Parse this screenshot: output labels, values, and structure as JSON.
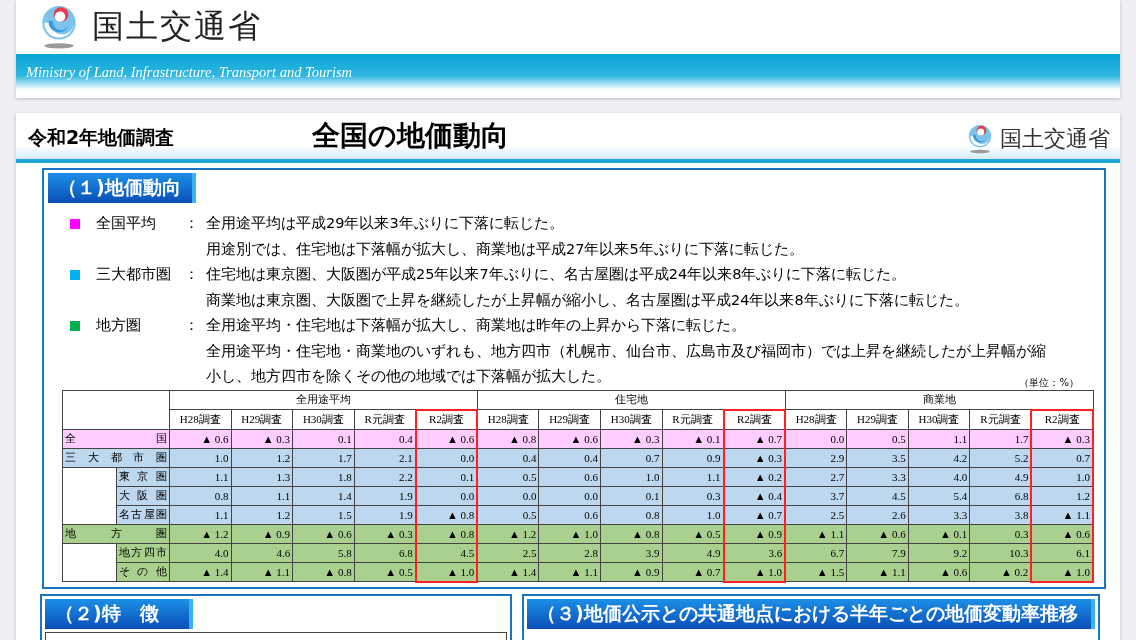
{
  "site_header": {
    "logo_text": "国土交通省",
    "tagline": "Ministry of Land, Infrastructure, Transport and Tourism"
  },
  "slide": {
    "survey_label": "令和2年地価調査",
    "title": "全国の地価動向",
    "logo_text": "国土交通省",
    "section_1": {
      "heading": "（１)地価動向",
      "summary": [
        {
          "label": "全国平均",
          "color": "#ff00ff",
          "separator": "：",
          "lines": [
            "全用途平均は平成29年以来3年ぶりに下落に転じた。",
            "用途別では、住宅地は下落幅が拡大し、商業地は平成27年以来5年ぶりに下落に転じた。"
          ]
        },
        {
          "label": "三大都市圏",
          "color": "#00b0f0",
          "separator": "：",
          "lines": [
            "住宅地は東京圏、大阪圏が平成25年以来7年ぶりに、名古屋圏は平成24年以来8年ぶりに下落に転じた。",
            "商業地は東京圏、大阪圏で上昇を継続したが上昇幅が縮小し、名古屋圏は平成24年以来8年ぶりに下落に転じた。"
          ]
        },
        {
          "label": "地方圏",
          "color": "#00b050",
          "separator": "：",
          "lines": [
            "全用途平均・住宅地は下落幅が拡大し、商業地は昨年の上昇から下落に転じた。",
            "全用途平均・住宅地・商業地のいずれも、地方四市（札幌市、仙台市、広島市及び福岡市）では上昇を継続したが上昇幅が縮",
            "小し、地方四市を除くその他の地域では下落幅が拡大した。"
          ]
        }
      ],
      "unit": "（単位：%）",
      "table": {
        "groups": [
          {
            "label": "全用途平均",
            "columns": [
              {
                "label": "H28調査",
                "highlighted": false
              },
              {
                "label": "H29調査",
                "highlighted": false
              },
              {
                "label": "H30調査",
                "highlighted": false
              },
              {
                "label": "R元調査",
                "highlighted": false
              },
              {
                "label": "R2調査",
                "highlighted": true
              }
            ]
          },
          {
            "label": "住宅地",
            "columns": [
              {
                "label": "H28調査",
                "highlighted": false
              },
              {
                "label": "H29調査",
                "highlighted": false
              },
              {
                "label": "H30調査",
                "highlighted": false
              },
              {
                "label": "R元調査",
                "highlighted": false
              },
              {
                "label": "R2調査",
                "highlighted": true
              }
            ]
          },
          {
            "label": "商業地",
            "columns": [
              {
                "label": "H28調査",
                "highlighted": false
              },
              {
                "label": "H29調査",
                "highlighted": false
              },
              {
                "label": "H30調査",
                "highlighted": false
              },
              {
                "label": "R元調査",
                "highlighted": false
              },
              {
                "label": "R2調査",
                "highlighted": true
              }
            ]
          }
        ],
        "rows": [
          {
            "label": "全国",
            "color": "#ffccff",
            "values": [
              "▲ 0.6",
              "▲ 0.3",
              "0.1",
              "0.4",
              "▲ 0.6",
              "▲ 0.8",
              "▲ 0.6",
              "▲ 0.3",
              "▲ 0.1",
              "▲ 0.7",
              "0.0",
              "0.5",
              "1.1",
              "1.7",
              "▲ 0.3"
            ]
          },
          {
            "label": "三大都市圏",
            "color": "#bdd7ee",
            "values": [
              "1.0",
              "1.2",
              "1.7",
              "2.1",
              "0.0",
              "0.4",
              "0.4",
              "0.7",
              "0.9",
              "▲ 0.3",
              "2.9",
              "3.5",
              "4.2",
              "5.2",
              "0.7"
            ],
            "children": [
              {
                "label": "東京圏",
                "values": [
                  "1.1",
                  "1.3",
                  "1.8",
                  "2.2",
                  "0.1",
                  "0.5",
                  "0.6",
                  "1.0",
                  "1.1",
                  "▲ 0.2",
                  "2.7",
                  "3.3",
                  "4.0",
                  "4.9",
                  "1.0"
                ]
              },
              {
                "label": "大阪圏",
                "values": [
                  "0.8",
                  "1.1",
                  "1.4",
                  "1.9",
                  "0.0",
                  "0.0",
                  "0.0",
                  "0.1",
                  "0.3",
                  "▲ 0.4",
                  "3.7",
                  "4.5",
                  "5.4",
                  "6.8",
                  "1.2"
                ]
              },
              {
                "label": "名古屋圏",
                "values": [
                  "1.1",
                  "1.2",
                  "1.5",
                  "1.9",
                  "▲ 0.8",
                  "0.5",
                  "0.6",
                  "0.8",
                  "1.0",
                  "▲ 0.7",
                  "2.5",
                  "2.6",
                  "3.3",
                  "3.8",
                  "▲ 1.1"
                ]
              }
            ]
          },
          {
            "label": "地方圏",
            "color": "#a9d08e",
            "values": [
              "▲ 1.2",
              "▲ 0.9",
              "▲ 0.6",
              "▲ 0.3",
              "▲ 0.8",
              "▲ 1.2",
              "▲ 1.0",
              "▲ 0.8",
              "▲ 0.5",
              "▲ 0.9",
              "▲ 1.1",
              "▲ 0.6",
              "▲ 0.1",
              "0.3",
              "▲ 0.6"
            ],
            "children": [
              {
                "label": "地方四市",
                "values": [
                  "4.0",
                  "4.6",
                  "5.8",
                  "6.8",
                  "4.5",
                  "2.5",
                  "2.8",
                  "3.9",
                  "4.9",
                  "3.6",
                  "6.7",
                  "7.9",
                  "9.2",
                  "10.3",
                  "6.1"
                ]
              },
              {
                "label": "その他",
                "values": [
                  "▲ 1.4",
                  "▲ 1.1",
                  "▲ 0.8",
                  "▲ 0.5",
                  "▲ 1.0",
                  "▲ 1.4",
                  "▲ 1.1",
                  "▲ 0.9",
                  "▲ 0.7",
                  "▲ 1.0",
                  "▲ 1.5",
                  "▲ 1.1",
                  "▲ 0.6",
                  "▲ 0.2",
                  "▲ 1.0"
                ]
              }
            ]
          }
        ]
      }
    },
    "section_2": {
      "heading": "（２)特　徴"
    },
    "section_3": {
      "heading": "（３)地価公示との共通地点における半年ごとの地価変動率推移"
    }
  }
}
